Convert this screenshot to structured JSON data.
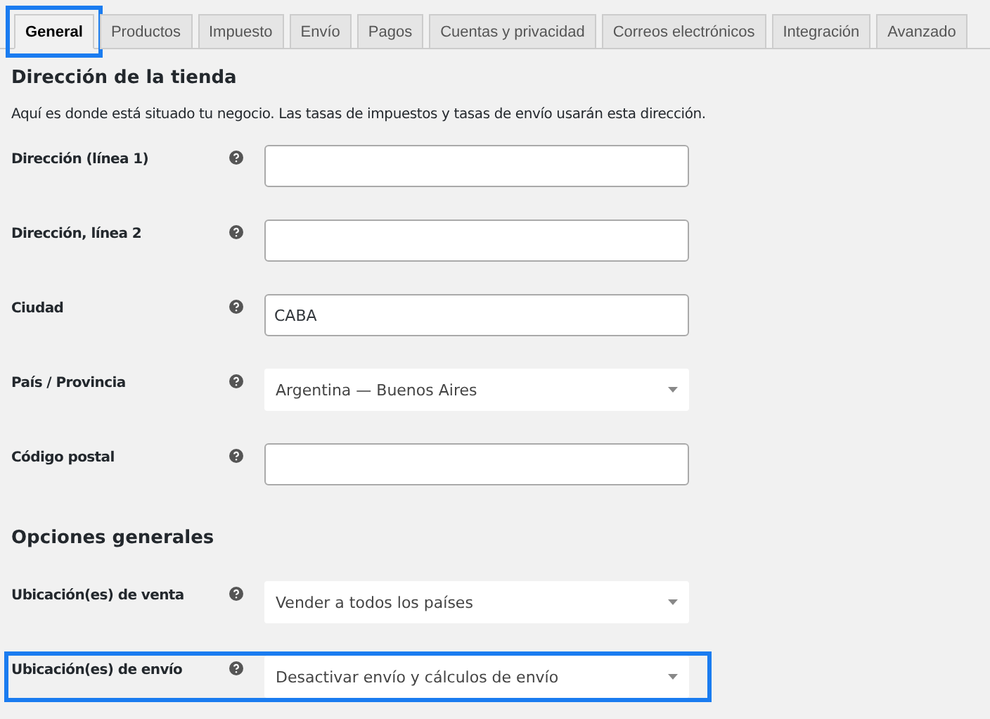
{
  "tabs": [
    {
      "label": "General",
      "selected": true,
      "highlighted": true
    },
    {
      "label": "Productos",
      "selected": false,
      "highlighted": false
    },
    {
      "label": "Impuesto",
      "selected": false,
      "highlighted": false
    },
    {
      "label": "Envío",
      "selected": false,
      "highlighted": false
    },
    {
      "label": "Pagos",
      "selected": false,
      "highlighted": false
    },
    {
      "label": "Cuentas y privacidad",
      "selected": false,
      "highlighted": false
    },
    {
      "label": "Correos electrónicos",
      "selected": false,
      "highlighted": false
    },
    {
      "label": "Integración",
      "selected": false,
      "highlighted": false
    },
    {
      "label": "Avanzado",
      "selected": false,
      "highlighted": false
    }
  ],
  "sections": [
    {
      "title": "Dirección de la tienda",
      "description": "Aquí es donde está situado tu negocio. Las tasas de impuestos y tasas de envío usarán esta dirección.",
      "fields": [
        {
          "label": "Dirección (línea 1)",
          "kind": "text",
          "highlighted": false
        },
        {
          "label": "Dirección, línea 2",
          "kind": "text",
          "highlighted": false
        },
        {
          "label": "Ciudad",
          "kind": "text",
          "value": "CABA",
          "highlighted": false
        },
        {
          "label": "País / Provincia",
          "kind": "select",
          "value": "Argentina — Buenos Aires",
          "highlighted": false
        },
        {
          "label": "Código postal",
          "kind": "text",
          "highlighted": false
        }
      ]
    },
    {
      "title": "Opciones generales",
      "fields": [
        {
          "label": "Ubicación(es) de venta",
          "kind": "select",
          "value": "Vender a todos los países",
          "highlighted": false
        },
        {
          "label": "Ubicación(es) de envío",
          "kind": "select",
          "value": "Desactivar envío y cálculos de envío",
          "highlighted": true
        }
      ]
    }
  ]
}
